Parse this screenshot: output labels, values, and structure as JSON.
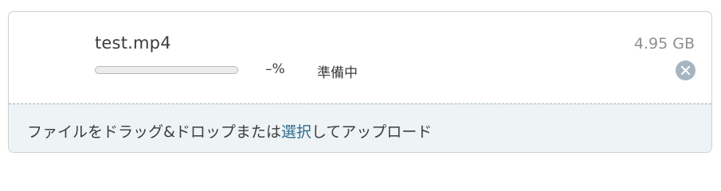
{
  "file": {
    "name": "test.mp4",
    "size": "4.95 GB",
    "progress_percent_text": "–%",
    "progress_fraction": 0,
    "status": "準備中"
  },
  "dropzone": {
    "text_before": "ファイルをドラッグ&ドロップまたは",
    "select_link": "選択",
    "text_after": "してアップロード"
  },
  "icons": {
    "remove": "close-circle-icon"
  },
  "colors": {
    "link": "#2f6e91",
    "dropzone_bg": "#eef4f6",
    "remove_icon_bg": "#a7b4c1",
    "progress_fill": "#5a97c8"
  }
}
